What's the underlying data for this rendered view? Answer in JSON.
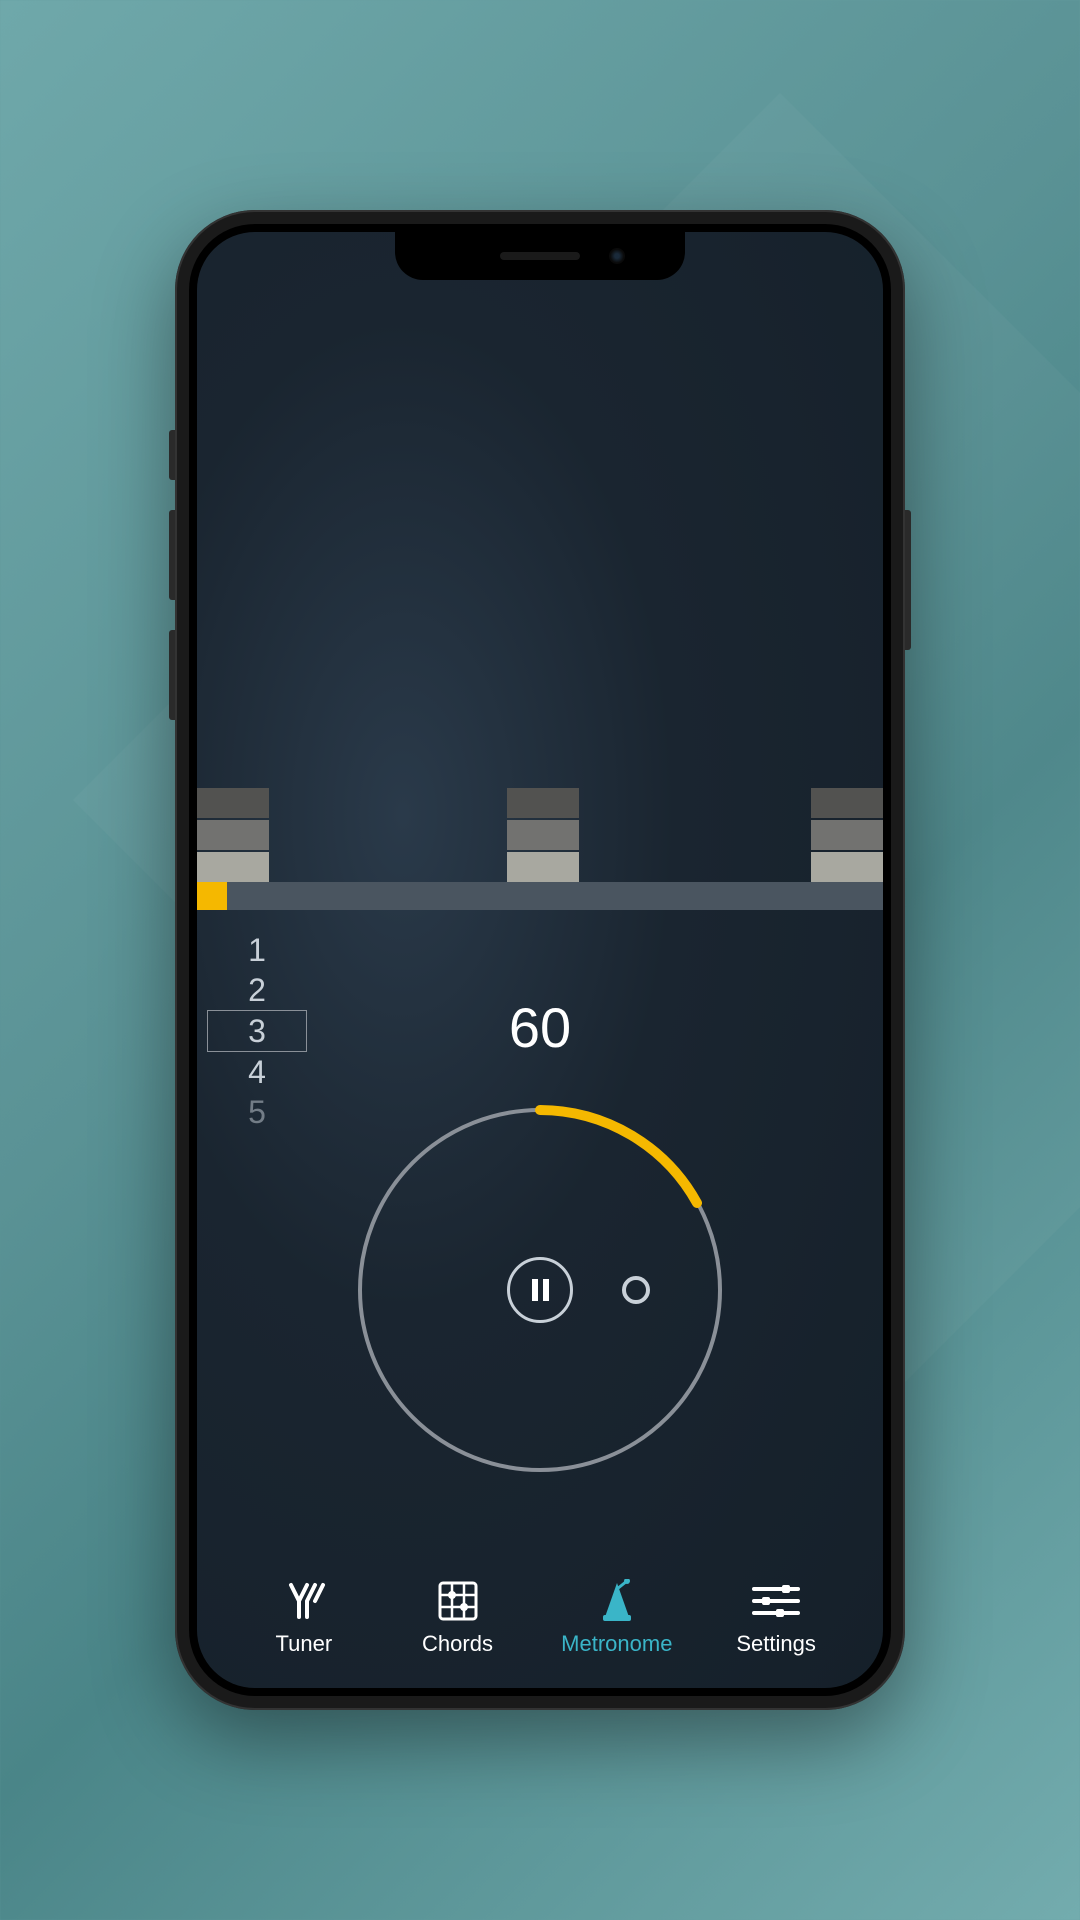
{
  "bpm": "60",
  "beat_picker": {
    "items": [
      "1",
      "2",
      "3",
      "4",
      "5"
    ],
    "selected_index": 2
  },
  "tabs": [
    {
      "id": "tuner",
      "label": "Tuner",
      "active": false
    },
    {
      "id": "chords",
      "label": "Chords",
      "active": false
    },
    {
      "id": "metronome",
      "label": "Metronome",
      "active": true
    },
    {
      "id": "settings",
      "label": "Settings",
      "active": false
    }
  ],
  "playback_state": "playing",
  "colors": {
    "accent": "#f5b800",
    "active_tab": "#3ab5c8"
  }
}
